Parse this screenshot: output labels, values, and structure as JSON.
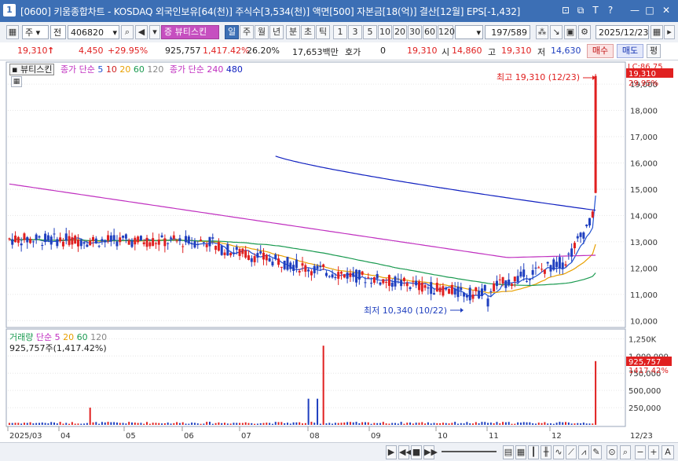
{
  "titlebar": {
    "num": "1",
    "text": "[0600] 키움종합차트 - KOSDAQ 외국인보유[64(천)] 주식수[3,534(천)] 액면[500] 자본금[18(억)] 결산[12월] EPS[-1,432]",
    "buttons": [
      "⊡",
      "⧉",
      "T",
      "?",
      "—",
      "□",
      "✕"
    ]
  },
  "toolbar": {
    "period_type": "주",
    "market": "전",
    "code": "406820",
    "stock_name": "뷰티스킨",
    "periods": [
      "일",
      "주",
      "월",
      "년",
      "분",
      "초",
      "틱"
    ],
    "selected_period": "일",
    "intervals": [
      "1",
      "3",
      "5",
      "10",
      "20",
      "30",
      "60",
      "120"
    ],
    "count": "197/589",
    "date": "2025/12/23"
  },
  "quote": {
    "price": "19,310",
    "arrow": "↑",
    "change": "4,450",
    "change_pct": "+29.95%",
    "volume": "925,757",
    "volume_pct": "1,417.42%",
    "turnover": "26.20%",
    "amount": "17,653백만",
    "hoga_label": "호가",
    "hoga": "0",
    "hoga_price": "19,310",
    "open_label": "시",
    "open": "14,860",
    "high_label": "고",
    "high": "19,310",
    "low_label": "저",
    "low": "14,630",
    "buy": "매수",
    "sell": "매도",
    "eval": "평"
  },
  "price_legend": {
    "name": "뷰티스킨",
    "ma_label": "종가 단순",
    "ma1": "5",
    "ma2": "10",
    "ma3": "20",
    "ma4": "60",
    "ma5": "120",
    "ma_long_label": "종가 단순",
    "ma_long1": "240",
    "ma_long2": "480"
  },
  "volume_legend": {
    "label": "거래량",
    "ma_label": "단순",
    "ma1": "5",
    "ma2": "20",
    "ma3": "60",
    "ma4": "120",
    "current": "925,757주(1,417.42%)"
  },
  "annotations": {
    "high": "최고 19,310 (12/23)",
    "low": "최저 10,340 (10/22)",
    "price_badge": "19,310",
    "pct_badge": "29.95%",
    "lc": "LC:86.75",
    "vol_badge": "925,757",
    "vol_pct_badge": "1417.42%"
  },
  "colors": {
    "up": "#e02020",
    "down": "#1f3fbf",
    "ma5": "#2050d0",
    "ma20": "#e8a000",
    "ma60": "#1a9a50",
    "ma120": "#555555",
    "ma240": "#c030c0",
    "ma480": "#1020c0",
    "brand": "#3c6fb5"
  },
  "chart_data": {
    "type": "candlestick",
    "y_ticks": [
      "19,000",
      "18,000",
      "17,000",
      "16,000",
      "15,000",
      "14,000",
      "13,000",
      "12,000",
      "11,000",
      "10,000"
    ],
    "ylim": [
      9800,
      19600
    ],
    "x_labels": [
      "2025/03",
      "04",
      "05",
      "06",
      "07",
      "08",
      "09",
      "10",
      "11",
      "12",
      "12/23"
    ],
    "volume_ticks": [
      "1,250K",
      "1,000,000",
      "750,000",
      "500,000",
      "250,000"
    ],
    "volume_ylim": [
      0,
      1300000
    ],
    "high_point": {
      "date": "12/23",
      "value": 19310
    },
    "low_point": {
      "date": "10/22",
      "value": 10340
    },
    "last_close": 19310,
    "last_volume": 925757
  }
}
